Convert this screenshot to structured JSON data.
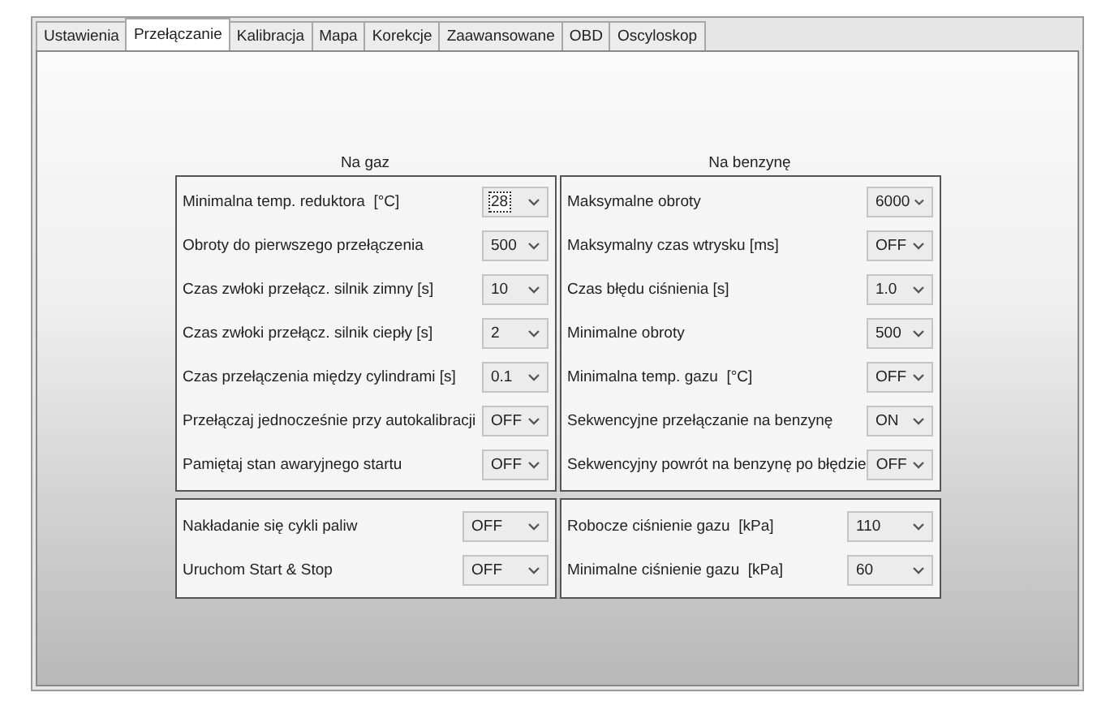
{
  "tabs": [
    {
      "label": "Ustawienia",
      "selected": false
    },
    {
      "label": "Przełączanie",
      "selected": true
    },
    {
      "label": "Kalibracja",
      "selected": false
    },
    {
      "label": "Mapa",
      "selected": false
    },
    {
      "label": "Korekcje",
      "selected": false
    },
    {
      "label": "Zaawansowane",
      "selected": false
    },
    {
      "label": "OBD",
      "selected": false
    },
    {
      "label": "Oscyloskop",
      "selected": false
    }
  ],
  "gas": {
    "title": "Na gaz",
    "rows": [
      {
        "label": "Minimalna temp. reduktora  [°C]",
        "value": "28",
        "focused": true
      },
      {
        "label": "Obroty do pierwszego przełączenia",
        "value": "500",
        "focused": false
      },
      {
        "label": "Czas zwłoki przełącz. silnik zimny [s]",
        "value": "10",
        "focused": false
      },
      {
        "label": "Czas zwłoki przełącz. silnik ciepły [s]",
        "value": "2",
        "focused": false
      },
      {
        "label": "Czas przełączenia między cylindrami [s]",
        "value": "0.1",
        "focused": false
      },
      {
        "label": "Przełączaj jednocześnie przy autokalibracji",
        "value": "OFF",
        "focused": false
      },
      {
        "label": "Pamiętaj stan awaryjnego startu",
        "value": "OFF",
        "focused": false
      }
    ]
  },
  "petrol": {
    "title": "Na benzynę",
    "rows": [
      {
        "label": "Maksymalne obroty",
        "value": "6000",
        "focused": false
      },
      {
        "label": "Maksymalny czas wtrysku [ms]",
        "value": "OFF",
        "focused": false
      },
      {
        "label": "Czas błędu ciśnienia [s]",
        "value": "1.0",
        "focused": false
      },
      {
        "label": "Minimalne obroty",
        "value": "500",
        "focused": false
      },
      {
        "label": "Minimalna temp. gazu  [°C]",
        "value": "OFF",
        "focused": false
      },
      {
        "label": "Sekwencyjne przełączanie na benzynę",
        "value": "ON",
        "focused": false
      },
      {
        "label": "Sekwencyjny powrót na benzynę po błędzie",
        "value": "OFF",
        "focused": false
      }
    ]
  },
  "extra_left": {
    "rows": [
      {
        "label": "Nakładanie się cykli paliw",
        "value": "OFF",
        "focused": false
      },
      {
        "label": "Uruchom Start & Stop",
        "value": "OFF",
        "focused": false
      }
    ]
  },
  "extra_right": {
    "rows": [
      {
        "label": "Robocze ciśnienie gazu  [kPa]",
        "value": "110",
        "focused": false
      },
      {
        "label": "Minimalne ciśnienie gazu  [kPa]",
        "value": "60",
        "focused": false
      }
    ]
  }
}
